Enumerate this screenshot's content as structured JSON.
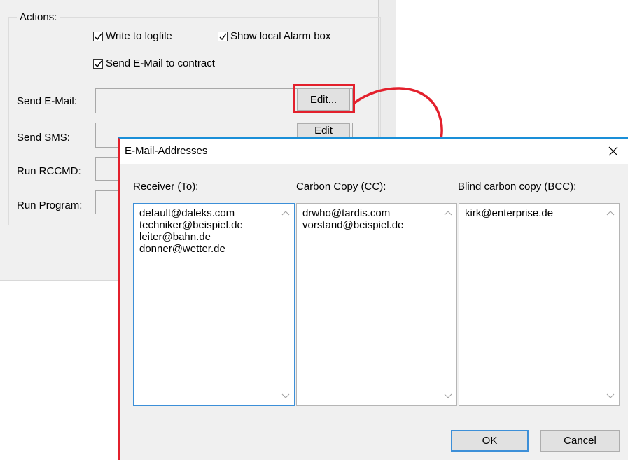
{
  "background_window": {
    "group_label": "Actions:",
    "checkboxes": [
      {
        "label": "Write to logfile",
        "checked": true
      },
      {
        "label": "Show local Alarm box",
        "checked": true
      },
      {
        "label": "Send E-Mail to contract",
        "checked": true
      }
    ],
    "rows": [
      {
        "label": "Send E-Mail:",
        "button": "Edit..."
      },
      {
        "label": "Send SMS:",
        "button": "Edit"
      },
      {
        "label": "Run RCCMD:"
      },
      {
        "label": "Run Program:"
      }
    ]
  },
  "dialog": {
    "title": "E-Mail-Addresses",
    "close_icon": "close-icon",
    "columns": [
      {
        "label": "Receiver (To):",
        "items": [
          "default@daleks.com",
          "techniker@beispiel.de",
          "leiter@bahn.de",
          "donner@wetter.de"
        ]
      },
      {
        "label": "Carbon Copy (CC):",
        "items": [
          "drwho@tardis.com",
          "vorstand@beispiel.de"
        ]
      },
      {
        "label": "Blind carbon copy (BCC):",
        "items": [
          "kirk@enterprise.de"
        ]
      }
    ],
    "ok_label": "OK",
    "cancel_label": "Cancel"
  },
  "colors": {
    "highlight": "#e3202c",
    "focus": "#3c8fd8",
    "title_accent": "#1a8fd8"
  }
}
